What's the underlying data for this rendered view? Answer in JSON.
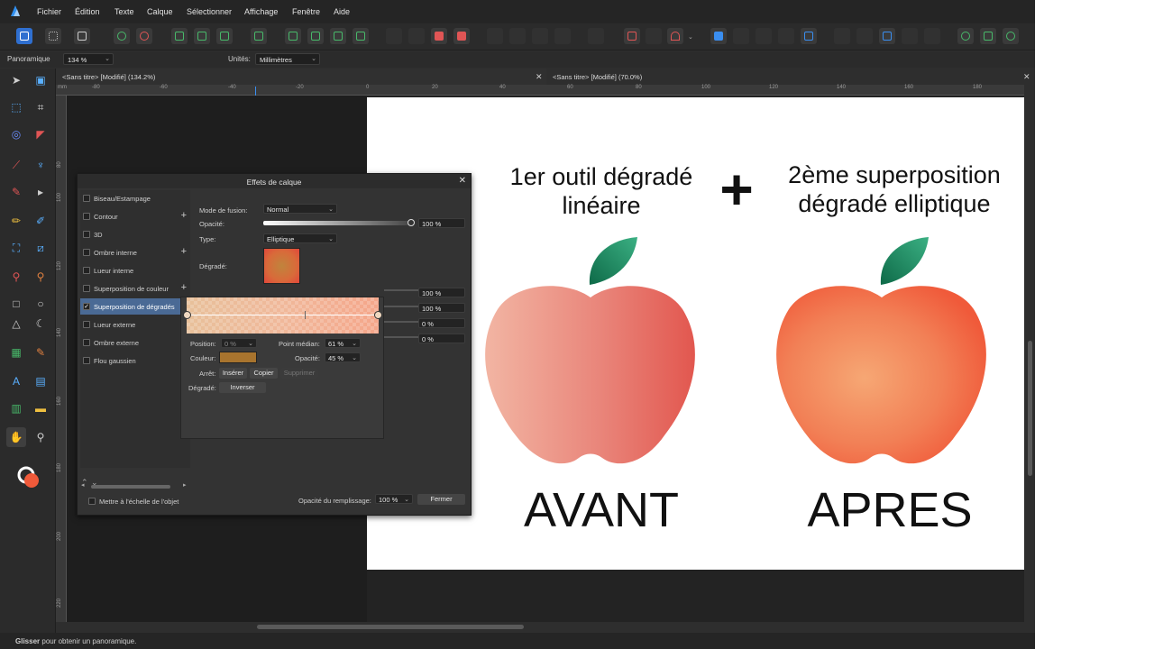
{
  "menu": [
    "Fichier",
    "Édition",
    "Texte",
    "Calque",
    "Sélectionner",
    "Affichage",
    "Fenêtre",
    "Aide"
  ],
  "context_bar": {
    "tool_name": "Panoramique",
    "zoom_value": "134 %",
    "units_label": "Unités:",
    "units_value": "Millimètres"
  },
  "tabs": [
    {
      "label": "<Sans titre> [Modifié] (134.2%)"
    },
    {
      "label": "<Sans titre> [Modifié] (70.0%)"
    }
  ],
  "ruler_top": [
    "-80",
    "-60",
    "-40",
    "-20",
    "0",
    "20",
    "40",
    "60",
    "80",
    "100",
    "120",
    "140",
    "160",
    "180"
  ],
  "ruler_left": [
    "80",
    "100",
    "120",
    "140",
    "160",
    "180",
    "200",
    "220"
  ],
  "ruler_unit": "mm",
  "artboard": {
    "left_title_line1": "1er outil dégradé",
    "left_title_line2": "linéaire",
    "plus": "+",
    "right_title_line1": "2ème superposition",
    "right_title_line2": "dégradé elliptique",
    "left_caption": "AVANT",
    "right_caption": "APRES"
  },
  "colors": {
    "leaf": "#1a7a55",
    "apple_linear_start": "#f2b5a3",
    "apple_linear_end": "#e2574f",
    "apple_elliptic_center": "#f6a774",
    "apple_elliptic_edge": "#f05a3a",
    "selection_blue": "#4a6a95"
  },
  "dialog": {
    "title": "Effets de calque",
    "effects": [
      {
        "label": "Biseau/Estampage",
        "checked": false,
        "plus": false
      },
      {
        "label": "Contour",
        "checked": false,
        "plus": true
      },
      {
        "label": "3D",
        "checked": false,
        "plus": false
      },
      {
        "label": "Ombre interne",
        "checked": false,
        "plus": true
      },
      {
        "label": "Lueur interne",
        "checked": false,
        "plus": false
      },
      {
        "label": "Superposition de couleur",
        "checked": false,
        "plus": true
      },
      {
        "label": "Superposition de dégradés",
        "checked": true,
        "plus": false
      },
      {
        "label": "Lueur externe",
        "checked": false,
        "plus": false
      },
      {
        "label": "Ombre externe",
        "checked": false,
        "plus": false
      },
      {
        "label": "Flou gaussien",
        "checked": false,
        "plus": false
      }
    ],
    "blend_label": "Mode de fusion:",
    "blend_value": "Normal",
    "opacity_label": "Opacité:",
    "opacity_value": "100 %",
    "type_label": "Type:",
    "type_value": "Elliptique",
    "gradient_label": "Dégradé:",
    "right_values": [
      "100 %",
      "100 %",
      "0 %",
      "0 %"
    ],
    "popup": {
      "position_label": "Position:",
      "position_value": "0 %",
      "midpoint_label": "Point médian:",
      "midpoint_value": "61 %",
      "color_label": "Couleur:",
      "color_swatch": "#a8742e",
      "stop_opacity_label": "Opacité:",
      "stop_opacity_value": "45 %",
      "stop_label": "Arrêt:",
      "insert": "Insérer",
      "copy": "Copier",
      "delete": "Supprimer",
      "gradient_label": "Dégradé:",
      "invert": "Inverser"
    },
    "scale_label": "Mettre à l'échelle de l'objet",
    "fill_opacity_label": "Opacité du remplissage:",
    "fill_opacity_value": "100 %",
    "close_label": "Fermer"
  },
  "status": {
    "bold": "Glisser",
    "text": " pour obtenir un panoramique."
  }
}
